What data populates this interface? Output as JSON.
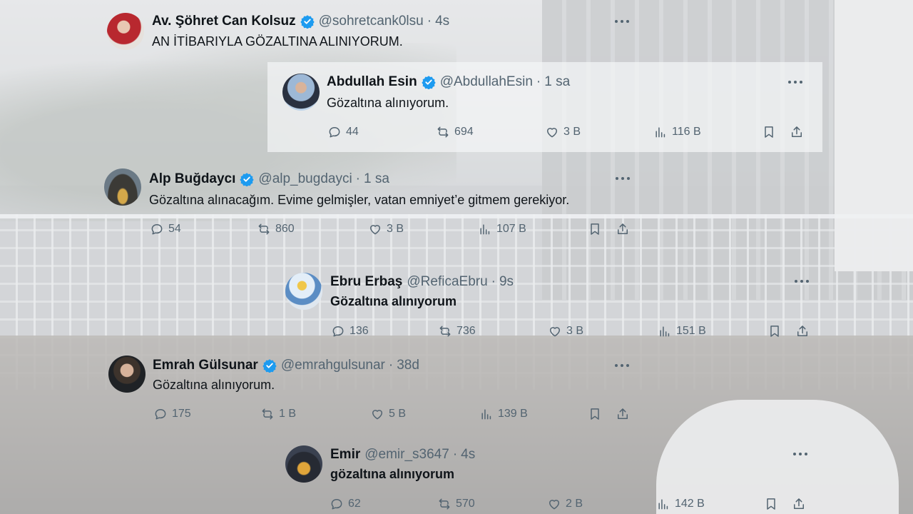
{
  "tweets": [
    {
      "name": "Av. Şöhret Can Kolsuz",
      "handle": "@sohretcank0lsu",
      "time": "4s",
      "text": "AN İTİBARIYLA GÖZALTINA ALINIYORUM."
    },
    {
      "name": "Abdullah Esin",
      "handle": "@AbdullahEsin",
      "time": "1 sa",
      "text": "Gözaltına alınıyorum.",
      "replies": "44",
      "reposts": "694",
      "likes": "3 B",
      "views": "116 B"
    },
    {
      "name": "Alp Buğdaycı",
      "handle": "@alp_bugdayci",
      "time": "1 sa",
      "text": "Gözaltına alınacağım. Evime gelmişler, vatan emniyet’e gitmem gerekiyor.",
      "replies": "54",
      "reposts": "860",
      "likes": "3 B",
      "views": "107 B"
    },
    {
      "name": "Ebru Erbaş",
      "handle": "@ReficaEbru",
      "time": "9s",
      "text": "Gözaltına alınıyorum",
      "replies": "136",
      "reposts": "736",
      "likes": "3 B",
      "views": "151 B"
    },
    {
      "name": "Emrah Gülsunar",
      "handle": "@emrahgulsunar",
      "time": "38d",
      "text": "Gözaltına alınıyorum.",
      "replies": "175",
      "reposts": "1 B",
      "likes": "5 B",
      "views": "139 B"
    },
    {
      "name": "Emir",
      "handle": "@emir_s3647",
      "time": "4s",
      "text": "gözaltına alınıyorum",
      "replies": "62",
      "reposts": "570",
      "likes": "2 B",
      "views": "142 B"
    }
  ],
  "colors": {
    "verified": "#1d9bf0",
    "text": "#0f1419",
    "muted": "#536471"
  },
  "icons": [
    "verified-badge-icon",
    "reply-icon",
    "repost-icon",
    "like-icon",
    "views-icon",
    "bookmark-icon",
    "share-icon",
    "more-icon"
  ]
}
